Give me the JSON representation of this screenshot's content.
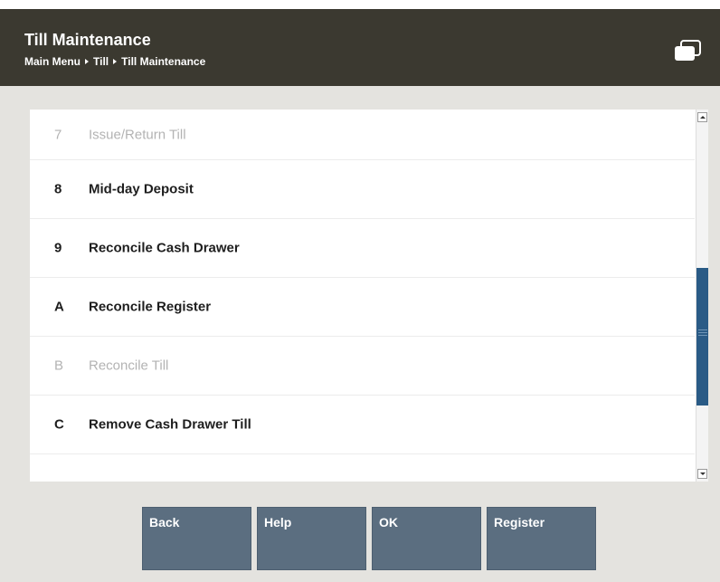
{
  "header": {
    "title": "Till Maintenance",
    "breadcrumb": [
      "Main Menu",
      "Till",
      "Till Maintenance"
    ],
    "icon": "window-icon"
  },
  "menu": {
    "items": [
      {
        "key": "7",
        "label": "Issue/Return Till",
        "enabled": false
      },
      {
        "key": "8",
        "label": "Mid-day Deposit",
        "enabled": true
      },
      {
        "key": "9",
        "label": "Reconcile Cash Drawer",
        "enabled": true
      },
      {
        "key": "A",
        "label": "Reconcile Register",
        "enabled": true
      },
      {
        "key": "B",
        "label": "Reconcile Till",
        "enabled": false
      },
      {
        "key": "C",
        "label": "Remove Cash Drawer Till",
        "enabled": true
      }
    ]
  },
  "buttons": {
    "back": "Back",
    "help": "Help",
    "ok": "OK",
    "register": "Register"
  },
  "colors": {
    "header_bg": "#3b3930",
    "button_bg": "#5b6e80",
    "scroll_thumb": "#2a5b86",
    "disabled_text": "#b3b3b3"
  }
}
